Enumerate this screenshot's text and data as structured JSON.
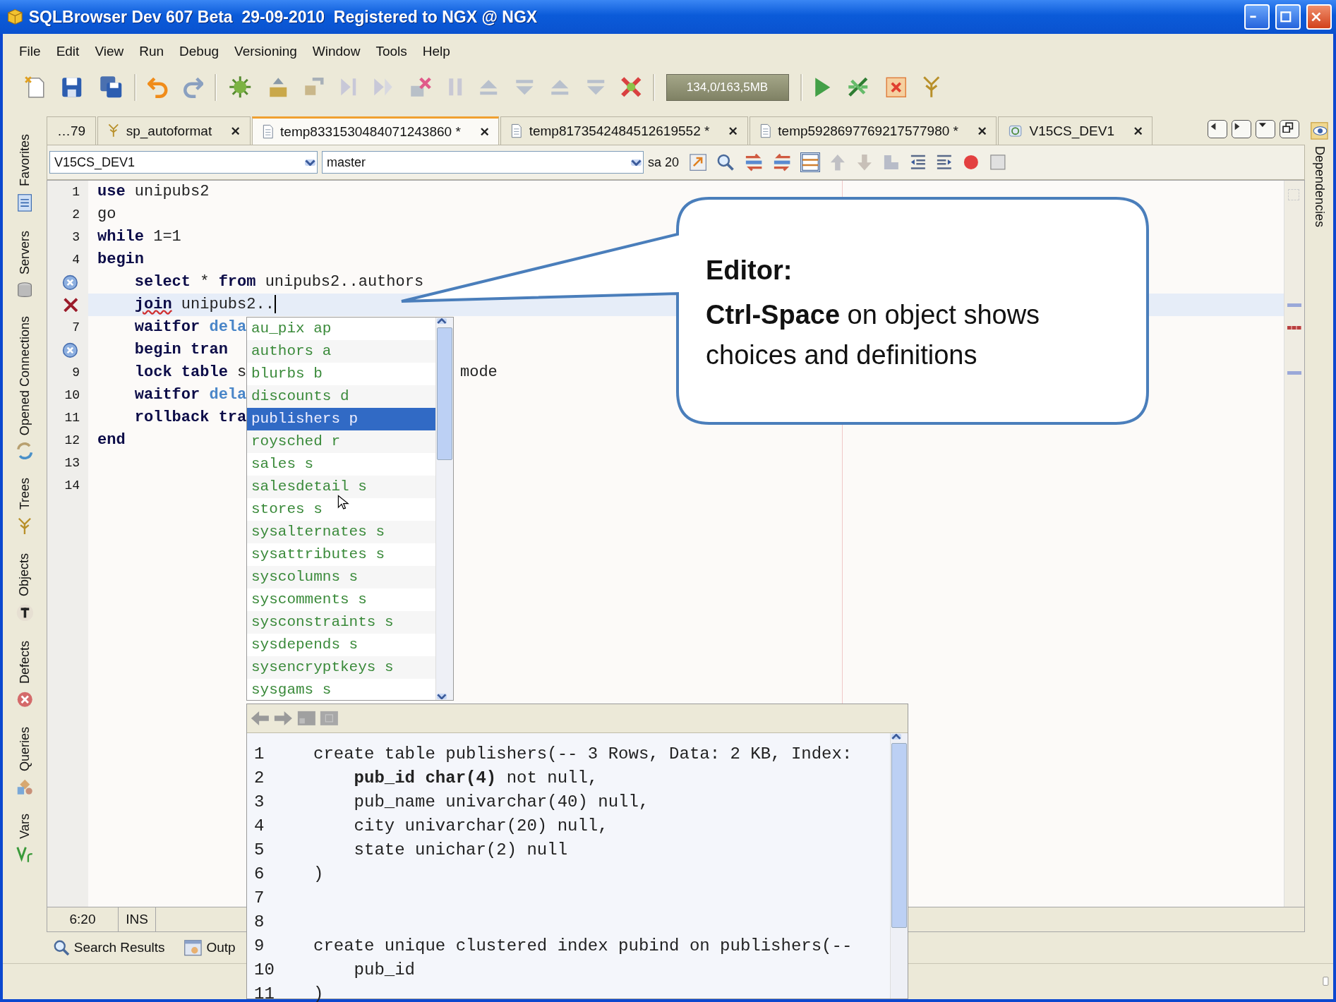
{
  "window": {
    "title": "SQLBrowser Dev 607 Beta  29-09-2010  Registered to NGX @ NGX"
  },
  "menu": [
    "File",
    "Edit",
    "View",
    "Run",
    "Debug",
    "Versioning",
    "Window",
    "Tools",
    "Help"
  ],
  "toolbar": {
    "memory": "134,0/163,5MB"
  },
  "left_panels": [
    {
      "label": "Favorites"
    },
    {
      "label": "Servers"
    },
    {
      "label": "Opened Connections"
    },
    {
      "label": "Trees"
    },
    {
      "label": "Objects"
    },
    {
      "label": "Defects"
    },
    {
      "label": "Queries"
    },
    {
      "label": "Vars"
    }
  ],
  "right_panels": [
    {
      "label": "Dependencies"
    }
  ],
  "tabs": [
    {
      "label": "…79",
      "kind": "overflow",
      "selected": false
    },
    {
      "label": "sp_autoformat",
      "kind": "procedure",
      "selected": false
    },
    {
      "label": "temp8331530484071243860 *",
      "kind": "script",
      "selected": true
    },
    {
      "label": "temp8173542484512619552 *",
      "kind": "script",
      "selected": false
    },
    {
      "label": "temp5928697769217577980 *",
      "kind": "script",
      "selected": false
    },
    {
      "label": "V15CS_DEV1",
      "kind": "connection",
      "selected": false
    }
  ],
  "connection": {
    "server": "V15CS_DEV1",
    "database": "master",
    "user": "sa 20"
  },
  "editor": {
    "lines": [
      {
        "number": "1",
        "segments": [
          {
            "kind": "keyword",
            "text": "use"
          },
          {
            "kind": "plain",
            "text": " unipubs2"
          }
        ]
      },
      {
        "number": "2",
        "segments": [
          {
            "kind": "plain",
            "text": "go"
          }
        ]
      },
      {
        "number": "3",
        "segments": [
          {
            "kind": "keyword",
            "text": "while"
          },
          {
            "kind": "plain",
            "text": " 1=1"
          }
        ]
      },
      {
        "number": "4",
        "segments": [
          {
            "kind": "keyword",
            "text": "begin"
          }
        ]
      },
      {
        "gutter": {
          "kind": "info"
        },
        "segments": [
          {
            "kind": "keyword",
            "text": "    select"
          },
          {
            "kind": "plain",
            "text": " * "
          },
          {
            "kind": "keyword",
            "text": "from"
          },
          {
            "kind": "plain",
            "text": " unipubs2..authors"
          }
        ]
      },
      {
        "gutter": {
          "kind": "error"
        },
        "current": true,
        "cursor": true,
        "stripe": {
          "kind": "info"
        },
        "segments": [
          {
            "kind": "keyword",
            "text": "    join",
            "squiggle": true
          },
          {
            "kind": "plain",
            "text": " unipubs2.."
          }
        ]
      },
      {
        "number": "7",
        "stripe": {
          "kind": "error"
        },
        "segments": [
          {
            "kind": "keyword",
            "text": "    waitfor"
          },
          {
            "kind": "func",
            "text": " dela"
          }
        ]
      },
      {
        "gutter": {
          "kind": "info"
        },
        "segments": [
          {
            "kind": "keyword",
            "text": "    begin tran"
          }
        ]
      },
      {
        "number": "9",
        "stripe": {
          "kind": "info"
        },
        "tail": "mode",
        "segments": [
          {
            "kind": "keyword",
            "text": "    lock table"
          },
          {
            "kind": "plain",
            "text": " s"
          }
        ]
      },
      {
        "number": "10",
        "segments": [
          {
            "kind": "keyword",
            "text": "    waitfor"
          },
          {
            "kind": "func",
            "text": " dela"
          }
        ]
      },
      {
        "number": "11",
        "segments": [
          {
            "kind": "keyword",
            "text": "    rollback tra"
          }
        ]
      },
      {
        "number": "12",
        "segments": [
          {
            "kind": "keyword",
            "text": "end"
          }
        ]
      },
      {
        "number": "13"
      },
      {
        "number": "14"
      }
    ]
  },
  "completion": {
    "items": [
      {
        "text": "au_pix ap",
        "selected": false
      },
      {
        "text": "authors a",
        "selected": false
      },
      {
        "text": "blurbs b",
        "selected": false
      },
      {
        "text": "discounts d",
        "selected": false
      },
      {
        "text": "publishers p",
        "selected": true
      },
      {
        "text": "roysched r",
        "selected": false
      },
      {
        "text": "sales s",
        "selected": false
      },
      {
        "text": "salesdetail s",
        "selected": false
      },
      {
        "text": "stores s",
        "selected": false
      },
      {
        "text": "sysalternates s",
        "selected": false
      },
      {
        "text": "sysattributes s",
        "selected": false
      },
      {
        "text": "syscolumns s",
        "selected": false
      },
      {
        "text": "syscomments s",
        "selected": false
      },
      {
        "text": "sysconstraints s",
        "selected": false
      },
      {
        "text": "sysdepends s",
        "selected": false
      },
      {
        "text": "sysencryptkeys s",
        "selected": false
      },
      {
        "text": "sysgams s",
        "selected": false
      }
    ]
  },
  "definition": {
    "lines": [
      {
        "number": "1",
        "code": "create table publishers(-- 3 Rows, Data: 2 KB, Index:"
      },
      {
        "number": "2",
        "code": "    **pub_id char(4)** not null,"
      },
      {
        "number": "3",
        "code": "    pub_name univarchar(40) null,"
      },
      {
        "number": "4",
        "code": "    city univarchar(20) null,"
      },
      {
        "number": "5",
        "code": "    state unichar(2) null"
      },
      {
        "number": "6",
        "code": ")"
      },
      {
        "number": "7"
      },
      {
        "number": "8"
      },
      {
        "number": "9",
        "code": "create unique clustered index pubind on publishers(--"
      },
      {
        "number": "10",
        "code": "    pub_id"
      },
      {
        "number": "11",
        "code": ")"
      }
    ]
  },
  "status": {
    "position": "6:20",
    "mode": "INS"
  },
  "bottom_tabs": [
    {
      "label": "Search Results"
    },
    {
      "label": "Outp"
    }
  ],
  "callout": {
    "title": "Editor:",
    "text": "**Ctrl-Space** on object shows choices and definitions"
  }
}
